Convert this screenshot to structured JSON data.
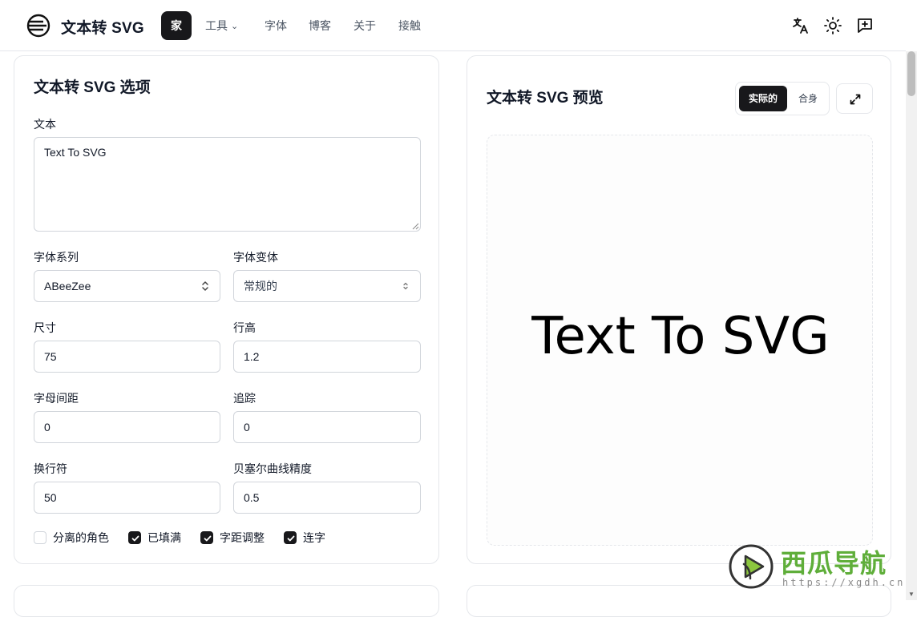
{
  "header": {
    "brand": "文本转 SVG",
    "nav": {
      "home": "家",
      "tools": "工具",
      "fonts": "字体",
      "blog": "博客",
      "about": "关于",
      "contact": "接触"
    },
    "icons": [
      "translate-icon",
      "sun-icon",
      "feedback-icon"
    ]
  },
  "options": {
    "title": "文本转 SVG 选项",
    "text_label": "文本",
    "text_value": "Text To SVG",
    "font_family_label": "字体系列",
    "font_family_value": "ABeeZee",
    "font_variant_label": "字体变体",
    "font_variant_value": "常规的",
    "size_label": "尺寸",
    "size_value": "75",
    "line_height_label": "行高",
    "line_height_value": "1.2",
    "letter_spacing_label": "字母间距",
    "letter_spacing_value": "0",
    "tracking_label": "追踪",
    "tracking_value": "0",
    "line_break_label": "换行符",
    "line_break_value": "50",
    "bezier_label": "贝塞尔曲线精度",
    "bezier_value": "0.5",
    "checkboxes": [
      {
        "label": "分离的角色",
        "checked": false
      },
      {
        "label": "已填满",
        "checked": true
      },
      {
        "label": "字距调整",
        "checked": true
      },
      {
        "label": "连字",
        "checked": true
      }
    ]
  },
  "preview": {
    "title": "文本转 SVG 预览",
    "toggle_actual": "实际的",
    "toggle_fit": "合身",
    "rendered_text": "Text To SVG"
  },
  "watermark": {
    "name": "西瓜导航",
    "url": "https://xgdh.cn"
  },
  "colors": {
    "accent": "#18181b",
    "border": "#e5e7eb",
    "watermark_green": "#5fae3a"
  }
}
